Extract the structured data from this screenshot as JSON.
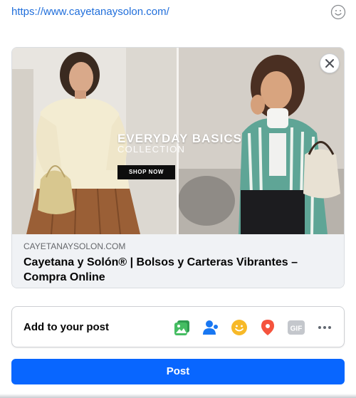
{
  "url_preview": {
    "url": "https://www.cayetanaysolon.com/"
  },
  "hero": {
    "headline": "EVERYDAY BASICS",
    "subheadline": "COLLECTION",
    "shop_button": "SHOP NOW"
  },
  "link": {
    "domain": "CAYETANAYSOLON.COM",
    "title": "Cayetana y Solón® | Bolsos y Carteras Vibrantes – Compra Online"
  },
  "add_to_post": {
    "label": "Add to your post",
    "tools": [
      {
        "name": "photo-video",
        "icon": "photo-icon",
        "color": "#45bd62"
      },
      {
        "name": "tag-people",
        "icon": "tag-people-icon",
        "color": "#1877f2"
      },
      {
        "name": "feeling-activity",
        "icon": "smiley-icon",
        "color": "#f7b928"
      },
      {
        "name": "check-in",
        "icon": "location-pin-icon",
        "color": "#f5533d"
      },
      {
        "name": "gif",
        "icon": "gif-icon",
        "color": "#c4c7cc"
      },
      {
        "name": "more",
        "icon": "more-dots-icon",
        "color": "#606770"
      }
    ]
  },
  "post_button": "Post",
  "colors": {
    "link": "#216fdb",
    "primary": "#0866ff",
    "card_bg": "#f0f2f5"
  }
}
